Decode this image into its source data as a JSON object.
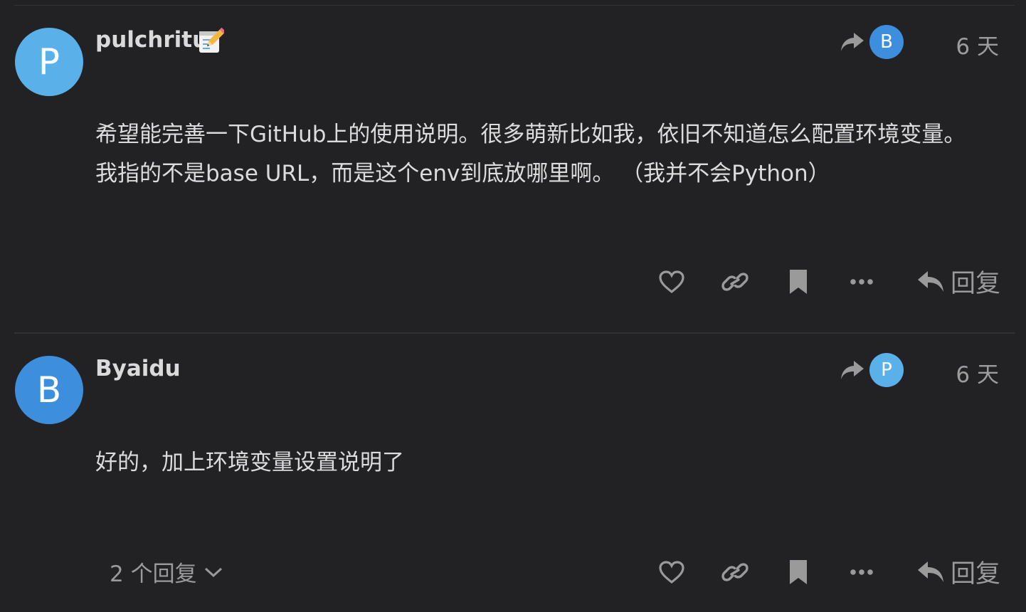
{
  "colors": {
    "background": "#222225",
    "avatar_p": "#5ab1ea",
    "avatar_b": "#3d8fde",
    "icon": "#9a9a9a"
  },
  "posts": [
    {
      "username": "pulchritu",
      "avatar_letter": "P",
      "reply_to_avatar_letter": "B",
      "date": "6 天",
      "body_lines": [
        "希望能完善一下GitHub上的使用说明。很多萌新比如我，依旧不知道怎么配置环境变量。",
        "我指的不是base URL，而是这个env到底放哪里啊。 （我并不会Python）"
      ],
      "reply_label": "回复"
    },
    {
      "username": "Byaidu",
      "avatar_letter": "B",
      "reply_to_avatar_letter": "P",
      "date": "6 天",
      "body_lines": [
        "好的，加上环境变量设置说明了"
      ],
      "replies_toggle": "2 个回复",
      "reply_label": "回复"
    }
  ],
  "icons": [
    "share-arrow-icon",
    "heart-icon",
    "link-icon",
    "bookmark-icon",
    "more-icon",
    "reply-icon",
    "chevron-down-icon",
    "memo-emoji-icon"
  ]
}
